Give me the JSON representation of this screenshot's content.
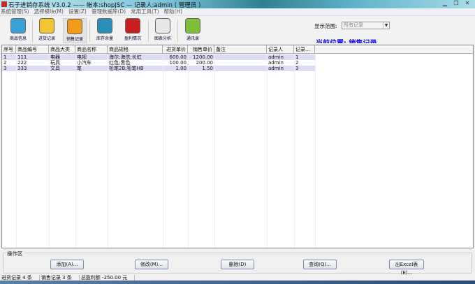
{
  "window": {
    "title": "石子进销存系统 V3.0.2 —— 帐本:shopJSC — 记录人:admin ( 管理员 )"
  },
  "menu": [
    "系统管理(S)",
    "选择模块(M)",
    "设置(Z)",
    "管理数据库(D)",
    "常用工具(T)",
    "帮助(H)"
  ],
  "toolbar": [
    {
      "label": "商品信息",
      "color": "#3aa0d8"
    },
    {
      "label": "进货记录",
      "color": "#f2c531"
    },
    {
      "label": "销售记录",
      "color": "#f29a1a"
    },
    {
      "label": "库存余量",
      "color": "#2a8fb8"
    },
    {
      "label": "盈利情况",
      "color": "#c81e1e"
    },
    {
      "label": "图表分析",
      "color": "#e8e8e8"
    },
    {
      "label": "通讯录",
      "color": "#7cc03a"
    }
  ],
  "range": {
    "label": "显示范围:",
    "value": "所有记录"
  },
  "position_text": "当前位置:   销售记录",
  "table": {
    "headers": [
      "序号",
      "商品编号",
      "商品大类",
      "商品名称",
      "商品规格",
      "进货单价",
      "销售单价",
      "备注",
      "记录人",
      "记录..."
    ],
    "rows": [
      [
        "1",
        "111",
        "电器",
        "电视",
        "海尔;海信;长虹",
        "600.00",
        "1200.00",
        "",
        "admin",
        "1"
      ],
      [
        "2",
        "222",
        "玩具",
        "小汽车",
        "红色;黑色",
        "100.00",
        "200.00",
        "",
        "admin",
        "2"
      ],
      [
        "3",
        "333",
        "文具",
        "笔",
        "铅笔2B;铅笔HB",
        "1.00",
        "1.50",
        "",
        "admin",
        "3"
      ]
    ]
  },
  "ops": {
    "title": "操作区",
    "buttons": [
      "添加(A)...",
      "修改(M)...",
      "删除(D)",
      "查询(Q)...",
      "出Excel表(E)..."
    ]
  },
  "status": [
    "进货记录 4 条",
    "销售记录 3 条",
    "总盈利额 -250.00 元"
  ]
}
